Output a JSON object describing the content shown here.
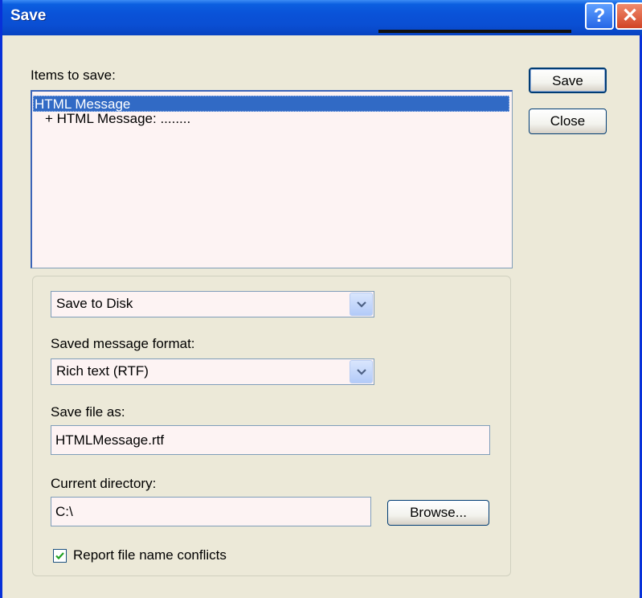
{
  "window": {
    "title": "Save"
  },
  "titlebar": {
    "help_label": "?",
    "close_label": "✕"
  },
  "items": {
    "label": "Items to save:",
    "list": [
      {
        "text": "HTML Message",
        "selected": true
      },
      {
        "text": "+ HTML Message: ........",
        "selected": false
      }
    ]
  },
  "buttons": {
    "save_label": "Save",
    "close_label": "Close",
    "browse_label": "Browse..."
  },
  "destination": {
    "selected": "Save to Disk"
  },
  "format": {
    "label": "Saved message format:",
    "selected": "Rich text (RTF)"
  },
  "file": {
    "label": "Save file as:",
    "value": "HTMLMessage.rtf"
  },
  "directory": {
    "label": "Current directory:",
    "value": "C:\\"
  },
  "conflicts": {
    "label": "Report file name conflicts",
    "checked": true
  },
  "colors": {
    "titlebar": "#0a52d8",
    "selection": "#316ac5",
    "dialog_bg": "#ece9d8"
  }
}
